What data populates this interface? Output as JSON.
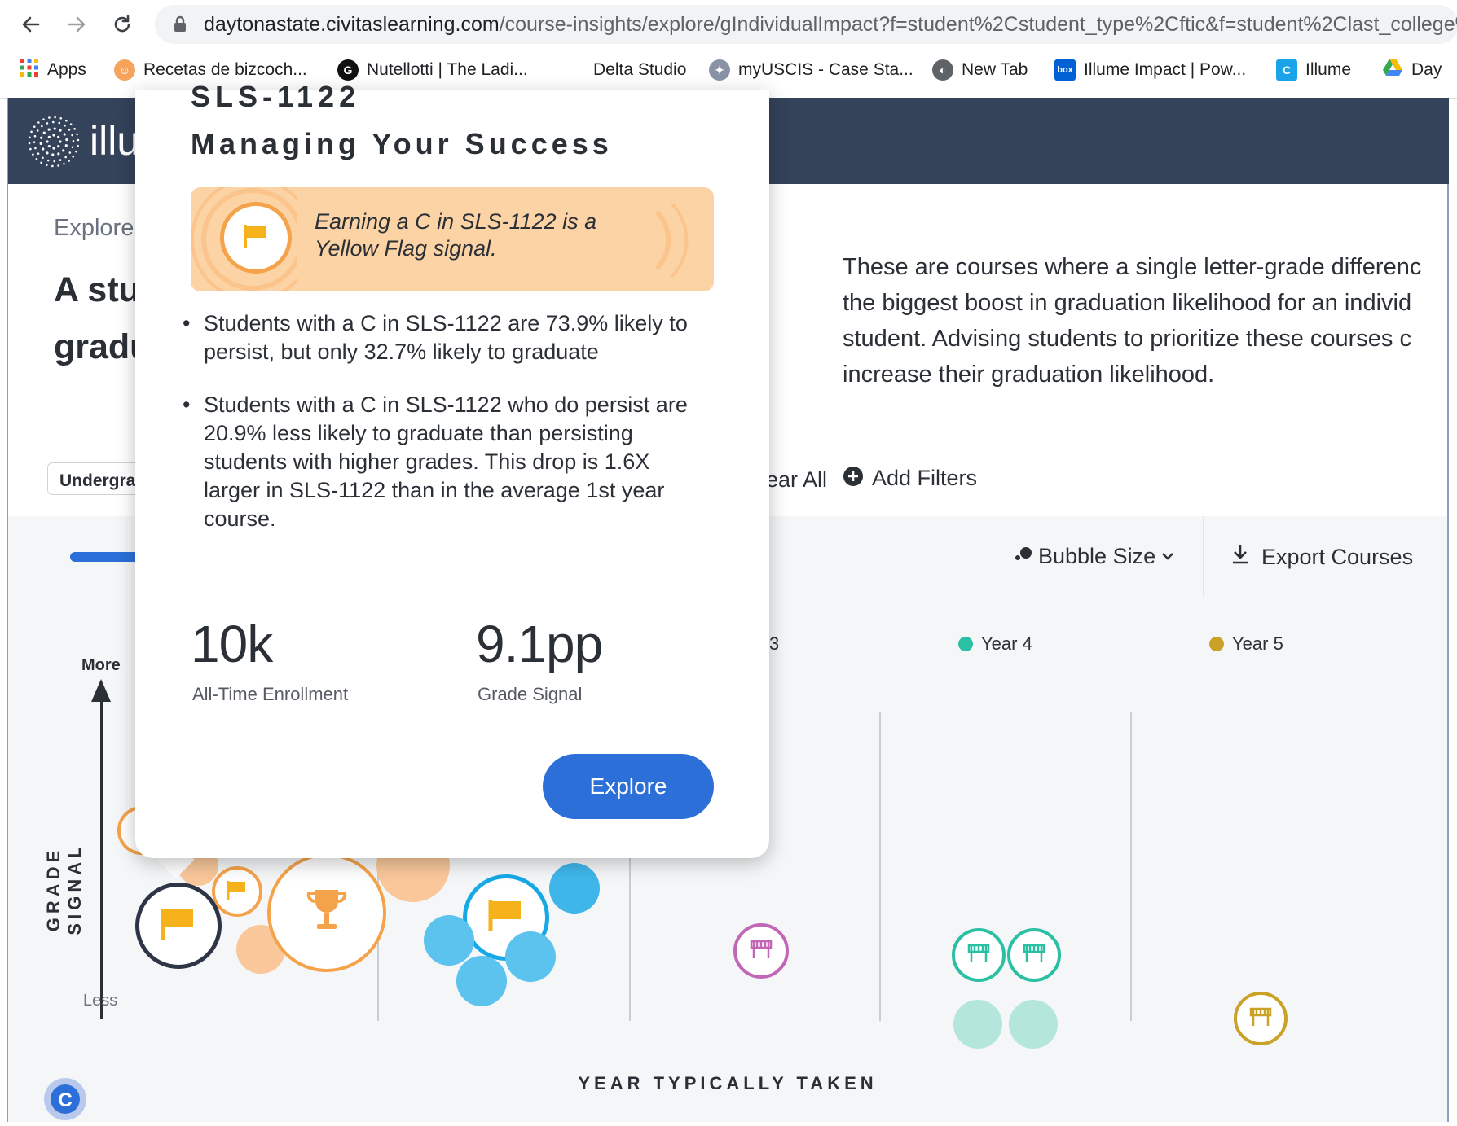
{
  "browser": {
    "url_host": "daytonastate.civitaslearning.com",
    "url_path": "/course-insights/explore/gIndividualImpact?f=student%2Cstudent_type%2Cftic&f=student%2Clast_college%",
    "bookmarks": [
      {
        "label": "Apps",
        "icon": "apps-grid-icon"
      },
      {
        "label": "Recetas de bizcoch...",
        "icon": "recipe-icon"
      },
      {
        "label": "Nutellotti | The Ladi...",
        "icon": "g-logo-icon"
      },
      {
        "label": "Delta Studio",
        "icon": "blank-icon"
      },
      {
        "label": "myUSCIS - Case Sta...",
        "icon": "uscis-seal-icon"
      },
      {
        "label": "New Tab",
        "icon": "globe-icon"
      },
      {
        "label": "Illume Impact | Pow...",
        "icon": "box-icon"
      },
      {
        "label": "Illume",
        "icon": "c-logo-icon"
      },
      {
        "label": "Day",
        "icon": "drive-icon"
      }
    ]
  },
  "app": {
    "logo_text": "illu",
    "breadcrumb": "Explore",
    "title_line1": "A stu",
    "title_line2": "gradu",
    "description": "These are courses where a single letter-grade difference has the biggest boost in graduation likelihood for an individual student. Advising students to prioritize these courses can increase their graduation likelihood.",
    "description_lines": [
      "These are courses where a single letter-grade differenc",
      "the biggest boost in graduation likelihood for an individ",
      "student. Advising students to prioritize these courses c",
      "increase their graduation likelihood."
    ],
    "filter_chip": "Undergra",
    "clear_all": "ear All",
    "add_filters": "Add Filters",
    "bubble_size": "Bubble Size",
    "export_courses": "Export Courses"
  },
  "popup": {
    "course_code": "SLS-1122",
    "course_name": "Managing Your Success",
    "signal_text_line1": "Earning a C in SLS-1122 is a",
    "signal_text_line2": "Yellow Flag signal.",
    "bullets": [
      [
        "Students with a C in SLS-1122 are 73.9% likely to",
        "persist, but only 32.7% likely to graduate"
      ],
      [
        "Students with a C in SLS-1122 who do persist are",
        "20.9% less likely to graduate than persisting",
        "students with higher grades. This drop is 1.6X",
        "larger in SLS-1122 than in the average 1st year",
        "course."
      ]
    ],
    "enrollment_value": "10k",
    "enrollment_label": "All-Time Enrollment",
    "grade_signal_value": "9.1pp",
    "grade_signal_label": "Grade Signal",
    "explore_button": "Explore"
  },
  "chart": {
    "y_axis_label": "GRADE SIGNAL",
    "y_more": "More",
    "y_less": "Less",
    "x_axis_label": "YEAR TYPICALLY TAKEN",
    "legend": [
      {
        "label": "3",
        "color": "#c266b8"
      },
      {
        "label": "Year 4",
        "color": "#2bbfa4"
      },
      {
        "label": "Year 5",
        "color": "#c9a227"
      }
    ],
    "colors": {
      "year1": "#f5a34a",
      "year2": "#3fb6ea",
      "year3": "#c266b8",
      "year4": "#2bbfa4",
      "year5": "#c9a227",
      "accent": "#2c6fd9",
      "selected": "#2e3546"
    }
  }
}
